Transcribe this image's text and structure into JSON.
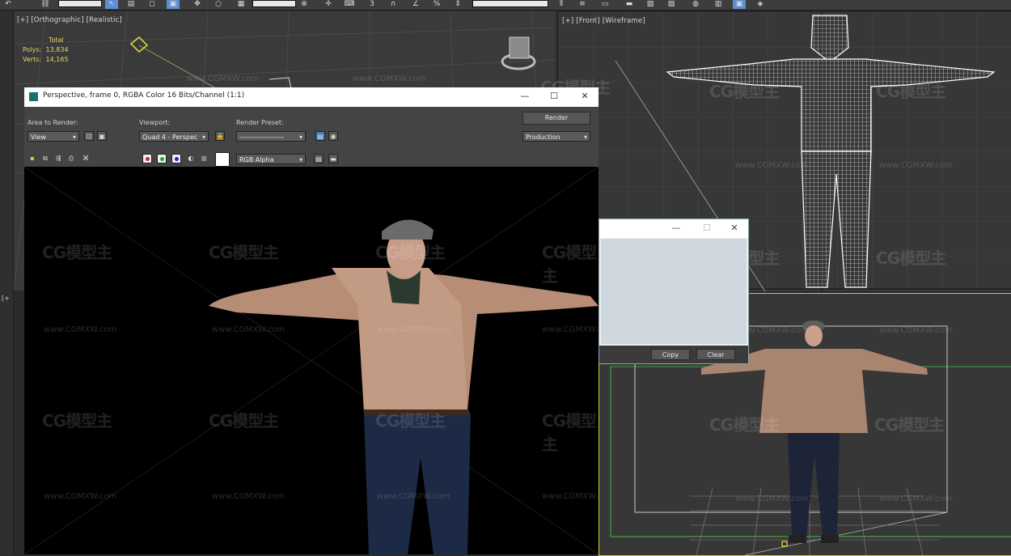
{
  "toolbar": {
    "icons": [
      "undo-icon",
      "link-icon",
      "select-icon",
      "select-region-icon",
      "select-filter-icon",
      "move-icon",
      "rotate-icon",
      "scale-icon",
      "snap-icon",
      "magnet-icon",
      "angle-snap-icon",
      "percent-snap-icon",
      "spinner-snap-icon",
      "named-sets-icon",
      "mirror-icon",
      "align-icon",
      "layer-icon",
      "curve-editor-icon",
      "schematic-icon",
      "material-editor-icon",
      "render-setup-icon",
      "render-frame-icon",
      "render-icon"
    ]
  },
  "viewport_ortho": {
    "label": "[+] [Orthographic] [Realistic]",
    "stats": {
      "header": "Total",
      "polys_label": "Polys:",
      "polys_value": "13,834",
      "verts_label": "Verts:",
      "verts_value": "14,165"
    }
  },
  "viewport_front": {
    "label": "[+] [Front] [Wireframe]"
  },
  "viewport_persp": {
    "label": "[+"
  },
  "render_window": {
    "title": "Perspective, frame 0, RGBA Color 16 Bits/Channel (1:1)",
    "area_to_render_label": "Area to Render:",
    "area_to_render_value": "View",
    "viewport_label": "Viewport:",
    "viewport_value": "Quad 4 - Perspec",
    "render_preset_label": "Render Preset:",
    "render_preset_value": "-------------------",
    "render_button": "Render",
    "production_value": "Production",
    "channel_value": "RGB Alpha",
    "minimize": "—",
    "maximize": "☐",
    "close": "✕"
  },
  "dialog": {
    "copy_button": "Copy",
    "clear_button": "Clear",
    "minimize": "—",
    "maximize": "☐",
    "close": "✕"
  },
  "watermark": {
    "logo_text": "CG模型主",
    "url_text": "www.CGMXW.com"
  },
  "colors": {
    "viewport_bg": "#3a3a3a",
    "active_viewport_border": "#c7d036",
    "stats_text": "#e4d85a",
    "render_bg": "#000000",
    "jacket": "#b98e78",
    "jeans": "#1d2a45",
    "cap": "#5a5a5a"
  }
}
